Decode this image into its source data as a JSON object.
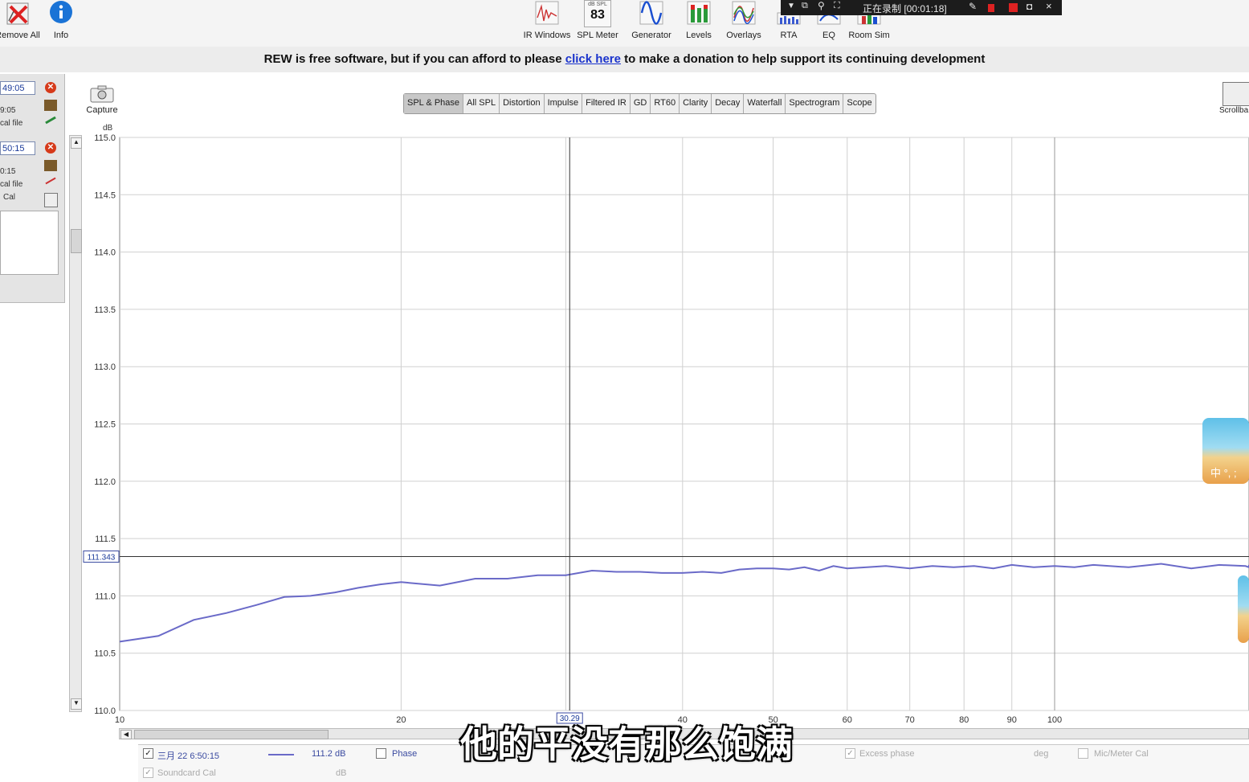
{
  "toolbar": {
    "left_buttons": [
      {
        "label": "Remove All",
        "icon": "remove-all-icon"
      },
      {
        "label": "Info",
        "icon": "info-icon"
      }
    ],
    "buttons": [
      {
        "label": "IR Windows",
        "icon": "ir-windows-icon"
      },
      {
        "label": "SPL Meter",
        "icon": "spl-meter-icon",
        "display_top": "dB SPL",
        "display_value": "83"
      },
      {
        "label": "Generator",
        "icon": "generator-icon"
      },
      {
        "label": "Levels",
        "icon": "levels-icon"
      },
      {
        "label": "Overlays",
        "icon": "overlays-icon"
      },
      {
        "label": "RTA",
        "icon": "rta-icon"
      },
      {
        "label": "EQ",
        "icon": "eq-icon"
      },
      {
        "label": "Room Sim",
        "icon": "room-sim-icon"
      }
    ]
  },
  "recording_bar": {
    "status": "正在录制 [00:01:18]"
  },
  "donation": {
    "before": "REW is free software, but if you can afford to please",
    "link": "click here",
    "after": "to make a donation to help support its continuing development"
  },
  "measurements": [
    {
      "name": "49:05",
      "time": "9:05",
      "cal": "cal file"
    },
    {
      "name": "50:15",
      "time": "0:15",
      "cal": "cal file",
      "cal2": "Cal"
    }
  ],
  "graph_controls": {
    "capture_label": "Capture",
    "scrollbar_label": "Scrollba"
  },
  "tabs": [
    "SPL & Phase",
    "All SPL",
    "Distortion",
    "Impulse",
    "Filtered IR",
    "GD",
    "RT60",
    "Clarity",
    "Decay",
    "Waterfall",
    "Spectrogram",
    "Scope"
  ],
  "active_tab": "SPL & Phase",
  "chart_data": {
    "type": "line",
    "ylabel": "dB",
    "ylim": [
      110.0,
      115.0
    ],
    "yticks": [
      "115.0",
      "114.5",
      "114.0",
      "113.5",
      "113.0",
      "112.5",
      "112.0",
      "111.5",
      "111.0",
      "110.5",
      "110.0"
    ],
    "xlim": [
      10,
      200
    ],
    "xscale": "log",
    "xticks": [
      "10",
      "20",
      "30",
      "40",
      "50",
      "60",
      "70",
      "80",
      "90",
      "100"
    ],
    "grid": true,
    "cursor": {
      "x": 30.29,
      "y": 111.343
    },
    "cursor_x_label": "30.29",
    "cursor_y_label": "111.343",
    "color": "#6a6ac8",
    "series": [
      {
        "x": [
          10,
          11,
          12,
          13,
          14,
          15,
          16,
          17,
          18,
          19,
          20,
          22,
          24,
          26,
          28,
          30,
          32,
          34,
          36,
          38,
          40,
          42,
          44,
          46,
          48,
          50,
          52,
          54,
          56,
          58,
          60,
          63,
          66,
          70,
          74,
          78,
          82,
          86,
          90,
          95,
          100,
          105,
          110,
          120,
          130,
          140,
          150,
          160,
          170,
          180,
          190,
          200
        ],
        "values": [
          110.6,
          110.65,
          110.79,
          110.85,
          110.92,
          110.99,
          111.0,
          111.03,
          111.07,
          111.1,
          111.12,
          111.09,
          111.15,
          111.15,
          111.18,
          111.18,
          111.22,
          111.21,
          111.21,
          111.2,
          111.2,
          111.21,
          111.2,
          111.23,
          111.24,
          111.24,
          111.23,
          111.25,
          111.22,
          111.26,
          111.24,
          111.25,
          111.26,
          111.24,
          111.26,
          111.25,
          111.26,
          111.24,
          111.27,
          111.25,
          111.26,
          111.25,
          111.27,
          111.25,
          111.28,
          111.24,
          111.27,
          111.26,
          111.25,
          111.27,
          111.26,
          111.27
        ]
      }
    ]
  },
  "legend": {
    "entry_name": "三月 22 6:50:15",
    "entry_value": "111.2 dB",
    "phase_label": "Phase",
    "excess_phase_label": "Excess phase",
    "deg_label": "deg",
    "mic_cal_label": "Mic/Meter Cal",
    "soundcard_cal_label": "Soundcard Cal",
    "db_label": "dB"
  },
  "subtitle": "他的平没有那么饱满",
  "side_widget_text": "中 °, ;"
}
